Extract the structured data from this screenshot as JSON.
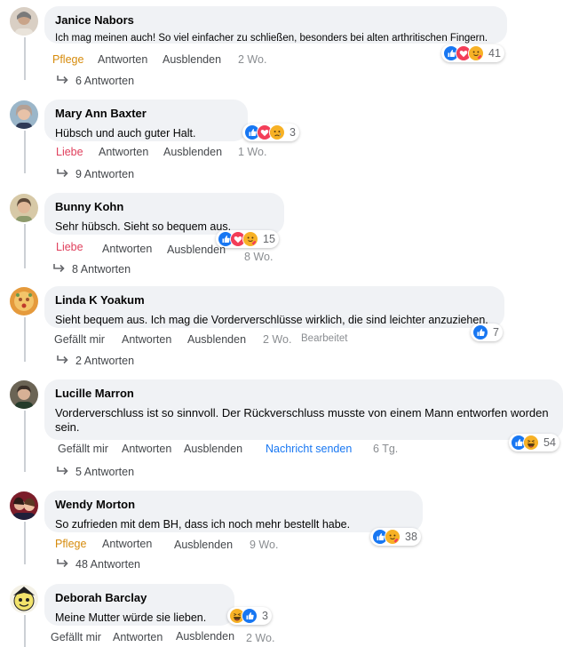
{
  "comments": [
    {
      "name": "Janice Nabors",
      "text": "Ich mag meinen auch! So viel einfacher zu schließen, besonders bei alten arthritischen Fingern.",
      "reaction_action": "Pflege",
      "reply": "Antworten",
      "hide": "Ausblenden",
      "time": "2 Wo.",
      "reaction_icons": [
        "like-icon",
        "love-icon",
        "care-icon"
      ],
      "reaction_count": "41",
      "replies": "6 Antworten"
    },
    {
      "name": "Mary Ann Baxter",
      "text": "Hübsch und auch guter Halt.",
      "reaction_action": "Liebe",
      "reply": "Antworten",
      "hide": "Ausblenden",
      "time": "1 Wo.",
      "reaction_icons": [
        "like-icon",
        "love-icon",
        "sad-icon"
      ],
      "reaction_count": "3",
      "replies": "9 Antworten"
    },
    {
      "name": "Bunny Kohn",
      "text": "Sehr hübsch. Sieht so bequem aus.",
      "reaction_action": "Liebe",
      "reply": "Antworten",
      "hide": "Ausblenden",
      "time": "8 Wo.",
      "reaction_icons": [
        "like-icon",
        "love-icon",
        "care-icon"
      ],
      "reaction_count": "15",
      "replies": "8 Antworten"
    },
    {
      "name": "Linda K Yoakum",
      "text": "Sieht bequem aus. Ich mag die Vorderverschlüsse wirklich, die sind leichter anzuziehen.",
      "reaction_action": "Gefällt mir",
      "reply": "Antworten",
      "hide": "Ausblenden",
      "time": "2 Wo.",
      "edited": "Bearbeitet",
      "reaction_icons": [
        "like-icon"
      ],
      "reaction_count": "7",
      "replies": "2 Antworten"
    },
    {
      "name": "Lucille Marron",
      "text": "Vorderverschluss ist so sinnvoll. Der Rückverschluss musste von einem Mann entworfen worden sein.",
      "reaction_action": "Gefällt mir",
      "reply": "Antworten",
      "hide": "Ausblenden",
      "message": "Nachricht senden",
      "time": "6 Tg.",
      "reaction_icons": [
        "like-icon",
        "haha-icon"
      ],
      "reaction_count": "54",
      "replies": "5 Antworten"
    },
    {
      "name": "Wendy Morton",
      "text": "So zufrieden mit dem BH, dass ich noch mehr bestellt habe.",
      "reaction_action": "Pflege",
      "reply": "Antworten",
      "hide": "Ausblenden",
      "time": "9 Wo.",
      "reaction_icons": [
        "like-icon",
        "care-icon"
      ],
      "reaction_count": "38",
      "replies": "48 Antworten"
    },
    {
      "name": "Deborah Barclay",
      "text": "Meine Mutter würde sie lieben.",
      "reaction_action": "Gefällt mir",
      "reply": "Antworten",
      "hide": "Ausblenden",
      "time": "2 Wo.",
      "reaction_icons": [
        "haha-icon",
        "like-icon"
      ],
      "reaction_count": "3"
    }
  ],
  "colors": {
    "bubble": "#f0f2f5",
    "like": "#1877f2",
    "love": "#f33e58",
    "care": "#f7b125",
    "link": "#1877f2",
    "pflege": "#d68b0c",
    "liebe": "#e0405d"
  }
}
